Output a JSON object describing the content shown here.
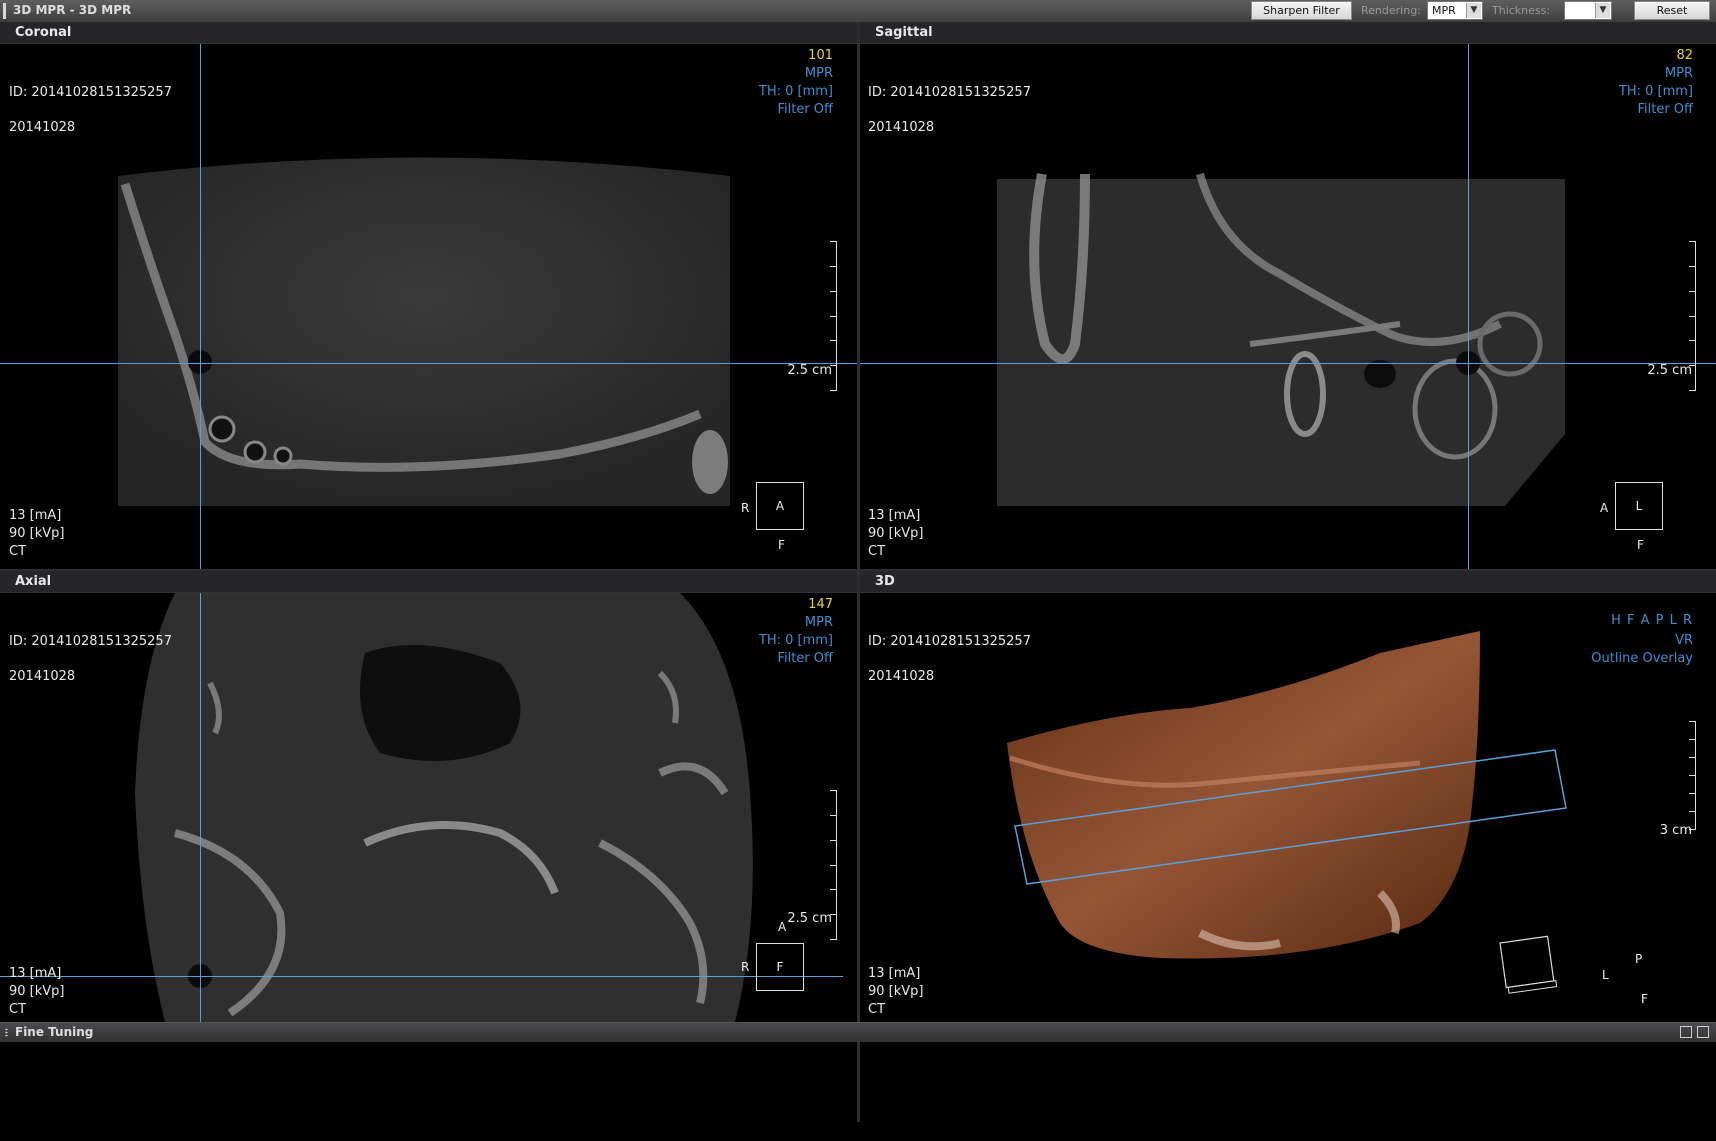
{
  "toolbar": {
    "title": "3D MPR - 3D MPR",
    "sharpen_label": "Sharpen Filter",
    "rendering_label": "Rendering:",
    "rendering_value": "MPR",
    "thickness_label": "Thickness:",
    "thickness_value": "",
    "reset_label": "Reset"
  },
  "coronal": {
    "title": "Coronal",
    "slice": "101",
    "id": "ID: 20141028151325257",
    "date": "20141028",
    "mode": "MPR",
    "thickness": "TH: 0 [mm]",
    "filter": "Filter Off",
    "scale": "2.5 cm",
    "ma": "13 [mA]",
    "kvp": "90 [kVp]",
    "modality": "CT",
    "orient_center": "A",
    "orient_left": "R",
    "orient_bottom": "F"
  },
  "sagittal": {
    "title": "Sagittal",
    "slice": "82",
    "id": "ID: 20141028151325257",
    "date": "20141028",
    "mode": "MPR",
    "thickness": "TH: 0 [mm]",
    "filter": "Filter Off",
    "scale": "2.5 cm",
    "ma": "13 [mA]",
    "kvp": "90 [kVp]",
    "modality": "CT",
    "orient_center": "L",
    "orient_left": "A",
    "orient_bottom": "F"
  },
  "axial": {
    "title": "Axial",
    "slice": "147",
    "id": "ID: 20141028151325257",
    "date": "20141028",
    "mode": "MPR",
    "thickness": "TH: 0 [mm]",
    "filter": "Filter Off",
    "scale": "2.5 cm",
    "ma": "13 [mA]",
    "kvp": "90 [kVp]",
    "modality": "CT",
    "orient_center": "F",
    "orient_left": "R",
    "orient_top": "A"
  },
  "threed": {
    "title": "3D",
    "id": "ID: 20141028151325257",
    "date": "20141028",
    "orient_buttons": "H F A P L R",
    "render_mode": "VR",
    "overlay": "Outline Overlay",
    "scale": "3 cm",
    "ma": "13 [mA]",
    "kvp": "90 [kVp]",
    "modality": "CT",
    "orient_center": "P",
    "orient_left": "L",
    "orient_bottom": "F"
  },
  "bottom": {
    "label": "Fine Tuning"
  },
  "colors": {
    "crosshair": "#5aa0d8",
    "overlay_blue": "#3e8fd0",
    "slice_yellow": "#e8d23a",
    "bone_3d": "#8a4a2a"
  }
}
